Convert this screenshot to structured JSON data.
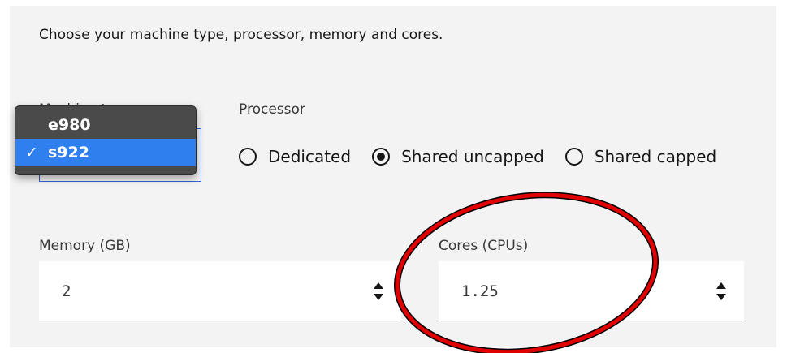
{
  "description": "Choose your machine type, processor, memory and cores.",
  "machine_type": {
    "label": "Machine type",
    "options": [
      {
        "label": "e980",
        "selected": false
      },
      {
        "label": "s922",
        "selected": true
      }
    ],
    "check_glyph": "✓"
  },
  "processor": {
    "label": "Processor",
    "options": [
      {
        "label": "Dedicated",
        "selected": false
      },
      {
        "label": "Shared uncapped",
        "selected": true
      },
      {
        "label": "Shared capped",
        "selected": false
      }
    ]
  },
  "memory": {
    "label": "Memory (GB)",
    "value": "2"
  },
  "cores": {
    "label": "Cores (CPUs)",
    "value": "1.25"
  },
  "colors": {
    "panel": "#f3f3f3",
    "dropdown_bg": "#4a4a4a",
    "dropdown_selected": "#2f7fef",
    "field_border": "#3562d6",
    "annotation": "#e00000"
  }
}
